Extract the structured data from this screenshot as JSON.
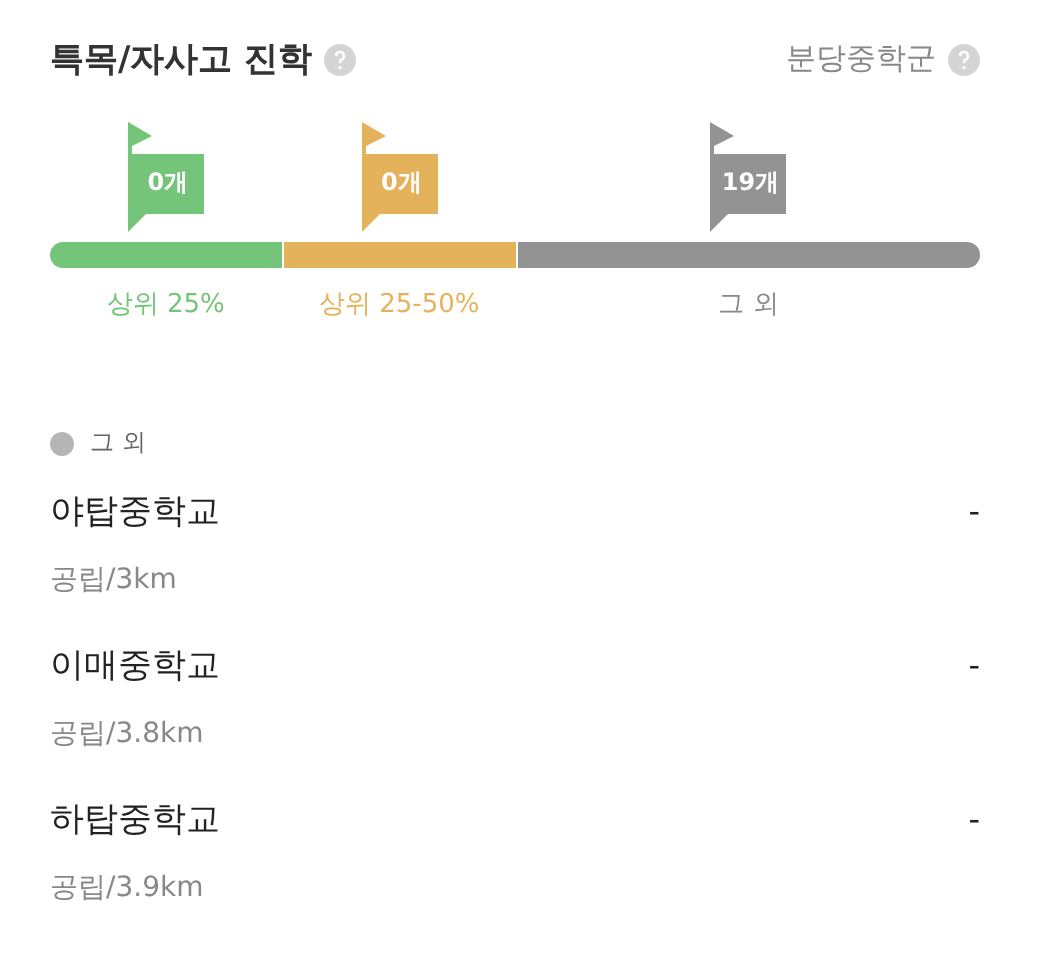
{
  "header": {
    "title": "특목/자사고 진학",
    "district": "분당중학군"
  },
  "segments": [
    {
      "kind": "top25",
      "count": "0개",
      "label": "상위 25%",
      "color": "#74c479"
    },
    {
      "kind": "top50",
      "count": "0개",
      "label": "상위 25-50%",
      "color": "#e5b25c"
    },
    {
      "kind": "other",
      "count": "19개",
      "label": "그 외",
      "color": "#939393"
    }
  ],
  "group": {
    "label": "그 외",
    "color": "#b5b5b5"
  },
  "schools": [
    {
      "name": "야탑중학교",
      "info": "공립/3km",
      "value": "-"
    },
    {
      "name": "이매중학교",
      "info": "공립/3.8km",
      "value": "-"
    },
    {
      "name": "하탑중학교",
      "info": "공립/3.9km",
      "value": "-"
    }
  ]
}
